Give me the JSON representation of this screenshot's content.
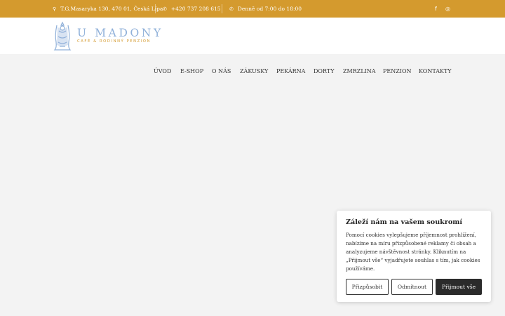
{
  "topbar": {
    "address": "T.G.Masaryka 130, 470 01, Česká Lípa",
    "phone": "+420 737 208 615",
    "hours": "Denně od 7:00 do 18:00",
    "address_icon": "map-pin-icon",
    "phone_icon": "phone-icon",
    "hours_icon": "phone-icon",
    "facebook": "f",
    "instagram": "◎"
  },
  "logo": {
    "title": "U MADONY",
    "subtitle": "CAFÉ & RODINNÝ PENZION"
  },
  "nav": {
    "items": [
      "ÚVOD",
      "E-SHOP",
      "O NÁS",
      "ZÁKUSKY",
      "PEKÁRNA",
      "DORTY",
      "ZMRZLINA",
      "PENZION",
      "KONTAKTY"
    ]
  },
  "cookie": {
    "title": "Záleží nám na vašem soukromí",
    "text": "Pomocí cookies vylepšujeme příjemnost prohlížení, nabízíme na míru přizpůsobené reklamy či obsah a analyzujeme návštěvnost stránky. Kliknutím na „Přijmout vše“ vyjadřujete souhlas s tím, jak cookies používáme.",
    "customize": "Přizpůsobit",
    "reject": "Odmítnout",
    "accept": "Přijmout vše"
  },
  "colors": {
    "topbar": "#d49a2e",
    "logo_blue": "#8fb0d9",
    "accent": "#d49a2e",
    "dark_button": "#2b2b2b"
  }
}
